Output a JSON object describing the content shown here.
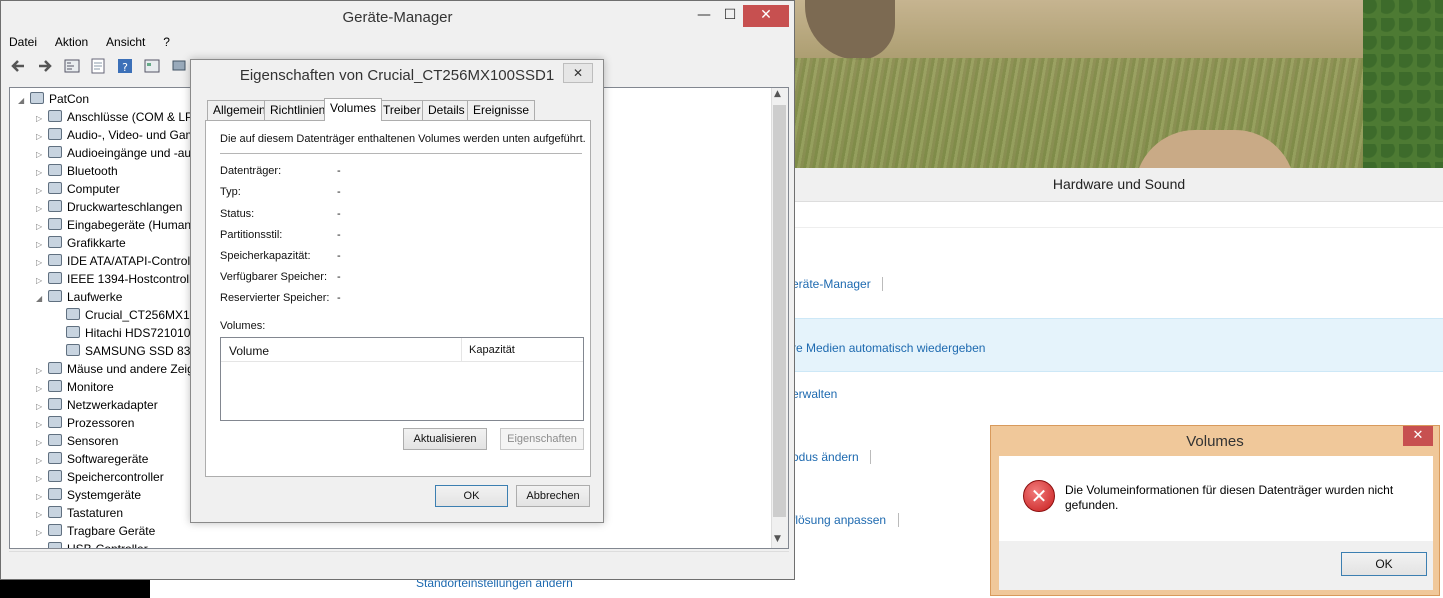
{
  "device_manager": {
    "title": "Geräte-Manager",
    "window_controls": {
      "minimize": "—",
      "maximize": "☐",
      "close": "✕"
    },
    "menu": [
      "Datei",
      "Aktion",
      "Ansicht",
      "?"
    ],
    "tree": {
      "root": "PatCon",
      "items": [
        "Anschlüsse (COM & LPT)",
        "Audio-, Video- und Gamecontroller",
        "Audioeingänge und -ausgänge",
        "Bluetooth",
        "Computer",
        "Druckwarteschlangen",
        "Eingabegeräte (Human Interface Devices)",
        "Grafikkarte",
        "IDE ATA/ATAPI-Controller",
        "IEEE 1394-Hostcontroller",
        "Laufwerke"
      ],
      "drives": [
        "Crucial_CT256MX100SSD1",
        "Hitachi HDS721010CLA332",
        "SAMSUNG SSD 830 Series"
      ],
      "items_after": [
        "Mäuse und andere Zeigegeräte",
        "Monitore",
        "Netzwerkadapter",
        "Prozessoren",
        "Sensoren",
        "Softwaregeräte",
        "Speichercontroller",
        "Systemgeräte",
        "Tastaturen",
        "Tragbare Geräte",
        "USB-Controller"
      ]
    }
  },
  "properties_dialog": {
    "title": "Eigenschaften von Crucial_CT256MX100SSD1",
    "close": "✕",
    "tabs": [
      "Allgemein",
      "Richtlinien",
      "Volumes",
      "Treiber",
      "Details",
      "Ereignisse"
    ],
    "active_tab": "Volumes",
    "description": "Die auf diesem Datenträger enthaltenen Volumes werden unten aufgeführt.",
    "fields": [
      {
        "label": "Datenträger:",
        "value": "-"
      },
      {
        "label": "Typ:",
        "value": "-"
      },
      {
        "label": "Status:",
        "value": "-"
      },
      {
        "label": "Partitionsstil:",
        "value": "-"
      },
      {
        "label": "Speicherkapazität:",
        "value": "-"
      },
      {
        "label": "Verfügbarer Speicher:",
        "value": "-"
      },
      {
        "label": "Reservierter Speicher:",
        "value": "-"
      }
    ],
    "volumes_label": "Volumes:",
    "table_headers": [
      "Volume",
      "Kapazität"
    ],
    "refresh_button": "Aktualisieren",
    "properties_button": "Eigenschaften",
    "ok_button": "OK",
    "cancel_button": "Abbrechen"
  },
  "control_panel": {
    "title": "Hardware und Sound",
    "links": [
      "eräte-Manager",
      "re Medien automatisch wiedergeben",
      "erwalten",
      "odus ändern",
      "flösung anpassen",
      "Standorteinstellungen ändern"
    ]
  },
  "error_dialog": {
    "title": "Volumes",
    "close": "✕",
    "icon": "error-icon",
    "message": "Die Volumeinformationen für diesen Datenträger wurden nicht gefunden.",
    "ok_button": "OK"
  }
}
